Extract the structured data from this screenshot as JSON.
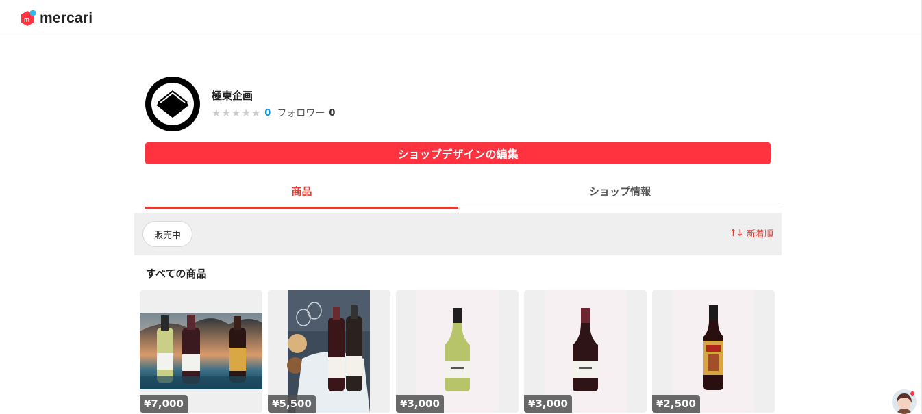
{
  "header": {
    "logo_text": "mercari"
  },
  "profile": {
    "shop_name": "極東企画",
    "rating_stars": 0,
    "rating_count": "0",
    "follower_label": "フォロワー",
    "follower_count": "0"
  },
  "edit_button_label": "ショップデザインの編集",
  "tabs": [
    {
      "label": "商品",
      "active": true
    },
    {
      "label": "ショップ情報",
      "active": false
    }
  ],
  "filter": {
    "chip_label": "販売中",
    "sort_label": "新着順",
    "sort_icon": "sort-arrows-icon"
  },
  "section_title": "すべての商品",
  "products": [
    {
      "price": "¥7,000",
      "image": "three-wine-bottles-splash"
    },
    {
      "price": "¥5,500",
      "image": "two-wine-bottles-basket"
    },
    {
      "price": "¥3,000",
      "image": "white-wine-bottle"
    },
    {
      "price": "¥3,000",
      "image": "red-wine-bottle"
    },
    {
      "price": "¥2,500",
      "image": "big-master-red-wine-bottle"
    }
  ],
  "colors": {
    "accent": "#ff333f",
    "tab_active": "#e13d34",
    "rating_count": "#0095ee"
  }
}
